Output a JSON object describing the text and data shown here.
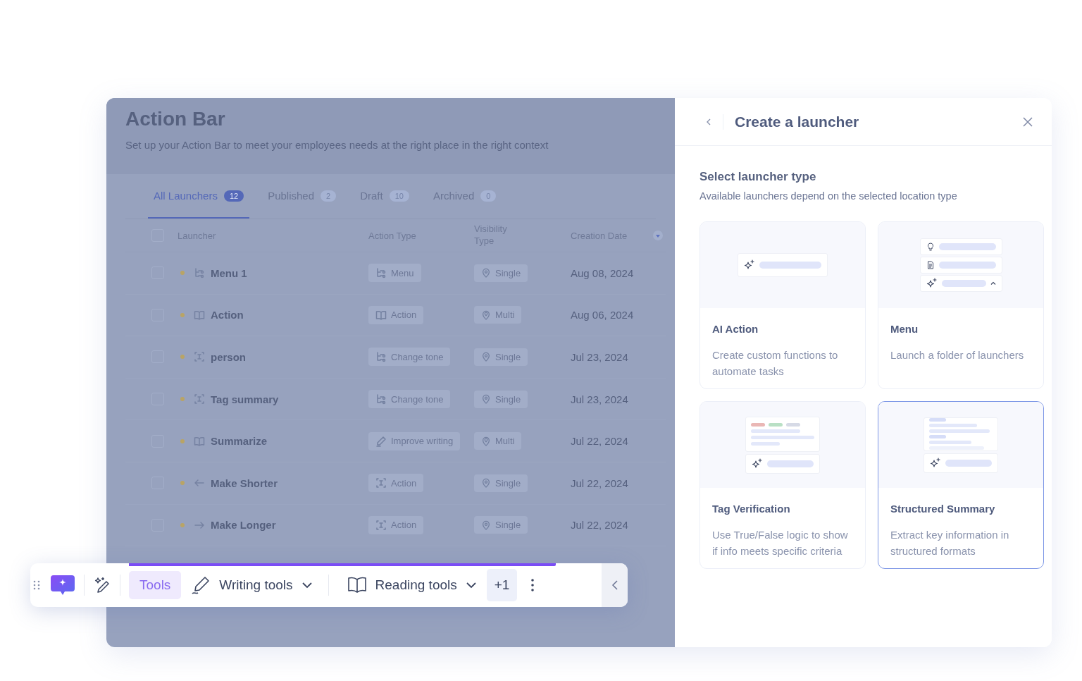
{
  "app": {
    "title": "Action Bar",
    "subtitle": "Set up your Action Bar to meet your employees needs at the right place in the right context",
    "tabs": [
      {
        "label": "All Launchers",
        "count": "12",
        "selected": true
      },
      {
        "label": "Published",
        "count": "2",
        "selected": false
      },
      {
        "label": "Draft",
        "count": "10",
        "selected": false
      },
      {
        "label": "Archived",
        "count": "0",
        "selected": false
      }
    ],
    "table": {
      "select_all_checked": false,
      "columns": [
        "Launcher",
        "Action Type",
        "Visibility Type",
        "Creation Date"
      ],
      "rows": [
        {
          "checked": false,
          "kind": "menu",
          "name": "Menu 1",
          "action_type": {
            "kind": "menu",
            "label": "Menu"
          },
          "visibility": {
            "kind": "single",
            "label": "Single"
          },
          "created": "Aug 08, 2024"
        },
        {
          "checked": false,
          "kind": "book",
          "name": "Action",
          "action_type": {
            "kind": "book",
            "label": "Action"
          },
          "visibility": {
            "kind": "multi",
            "label": "Multi"
          },
          "created": "Aug 06, 2024"
        },
        {
          "checked": false,
          "kind": "bracket",
          "name": "person",
          "action_type": {
            "kind": "menu",
            "label": "Change tone"
          },
          "visibility": {
            "kind": "single",
            "label": "Single"
          },
          "created": "Jul 23, 2024"
        },
        {
          "checked": false,
          "kind": "bracket",
          "name": "Tag summary",
          "action_type": {
            "kind": "menu",
            "label": "Change tone"
          },
          "visibility": {
            "kind": "single",
            "label": "Single"
          },
          "created": "Jul 23, 2024"
        },
        {
          "checked": false,
          "kind": "book",
          "name": "Summarize",
          "action_type": {
            "kind": "pencil",
            "label": "Improve writing"
          },
          "visibility": {
            "kind": "multi",
            "label": "Multi"
          },
          "created": "Jul 22, 2024"
        },
        {
          "checked": false,
          "kind": "left",
          "name": "Make Shorter",
          "action_type": {
            "kind": "bracket",
            "label": "Action"
          },
          "visibility": {
            "kind": "single",
            "label": "Single"
          },
          "created": "Jul 22, 2024"
        },
        {
          "checked": false,
          "kind": "right",
          "name": "Make Longer",
          "action_type": {
            "kind": "bracket",
            "label": "Action"
          },
          "visibility": {
            "kind": "single",
            "label": "Single"
          },
          "created": "Jul 22, 2024"
        }
      ]
    }
  },
  "panel": {
    "title": "Create a launcher",
    "heading": "Select launcher type",
    "subheading": "Available launchers depend on the selected location type",
    "cards": [
      {
        "kind": "ai-action",
        "title": "AI Action",
        "description": "Create custom functions to automate tasks",
        "selected": false
      },
      {
        "kind": "menu",
        "title": "Menu",
        "description": "Launch a folder of launchers",
        "selected": false
      },
      {
        "kind": "tag-verification",
        "title": "Tag Verification",
        "description": "Use True/False logic to show if info meets specific criteria",
        "selected": false
      },
      {
        "kind": "structured-summary",
        "title": "Structured Summary",
        "description": "Extract key information in structured formats",
        "selected": true
      }
    ]
  },
  "toolbar": {
    "items": [
      {
        "kind": "tab",
        "label": "Tools",
        "selected": true
      },
      {
        "kind": "writing-dropdown",
        "label": "Writing tools"
      },
      {
        "kind": "reading-dropdown",
        "label": "Reading tools"
      },
      {
        "kind": "count",
        "label": "+1"
      }
    ]
  }
}
